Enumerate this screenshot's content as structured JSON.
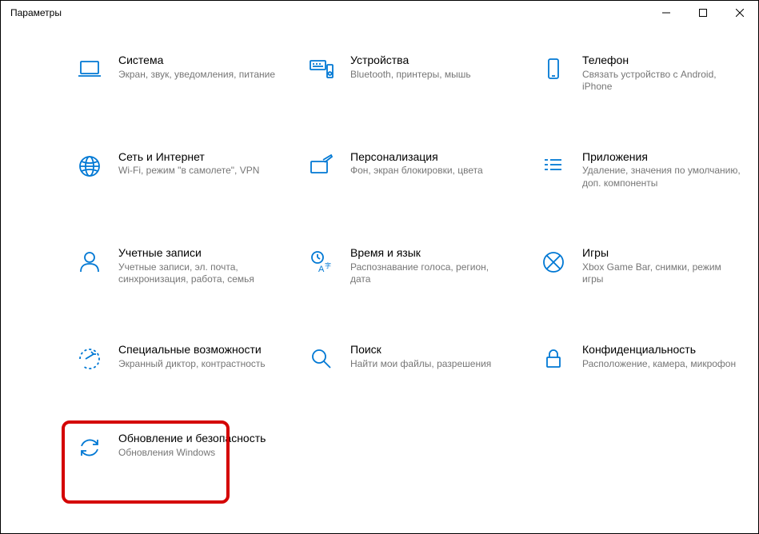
{
  "window": {
    "title": "Параметры"
  },
  "tiles": [
    {
      "title": "Система",
      "desc": "Экран, звук, уведомления, питание"
    },
    {
      "title": "Устройства",
      "desc": "Bluetooth, принтеры, мышь"
    },
    {
      "title": "Телефон",
      "desc": "Связать устройство с Android, iPhone"
    },
    {
      "title": "Сеть и Интернет",
      "desc": "Wi-Fi, режим \"в самолете\", VPN"
    },
    {
      "title": "Персонализация",
      "desc": "Фон, экран блокировки, цвета"
    },
    {
      "title": "Приложения",
      "desc": "Удаление, значения по умолчанию, доп. компоненты"
    },
    {
      "title": "Учетные записи",
      "desc": "Учетные записи, эл. почта, синхронизация, работа, семья"
    },
    {
      "title": "Время и язык",
      "desc": "Распознавание голоса, регион, дата"
    },
    {
      "title": "Игры",
      "desc": "Xbox Game Bar, снимки, режим игры"
    },
    {
      "title": "Специальные возможности",
      "desc": "Экранный диктор, контрастность"
    },
    {
      "title": "Поиск",
      "desc": "Найти мои файлы, разрешения"
    },
    {
      "title": "Конфиденциальность",
      "desc": "Расположение, камера, микрофон"
    },
    {
      "title": "Обновление и безопасность",
      "desc": "Обновления Windows"
    }
  ],
  "colors": {
    "accent": "#0078D4",
    "highlight": "#d40000",
    "desc": "#767676"
  }
}
